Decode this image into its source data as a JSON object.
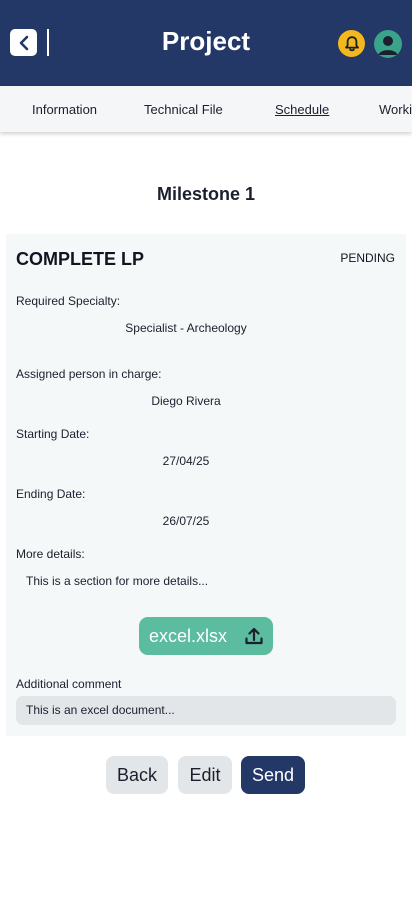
{
  "header": {
    "title": "Project",
    "back_icon": "chevron-left-icon",
    "notification_icon": "bell-icon",
    "profile_icon": "user-avatar-icon",
    "colors": {
      "primary": "#243867",
      "bell": "#f2b81d",
      "avatar": "#3aa48a"
    }
  },
  "tabs": [
    {
      "label": "Information",
      "active": false
    },
    {
      "label": "Technical File",
      "active": false
    },
    {
      "label": "Schedule",
      "active": true
    },
    {
      "label": "Working",
      "active": false
    }
  ],
  "milestone": {
    "title": "Milestone 1"
  },
  "task": {
    "title": "COMPLETE LP",
    "status": "PENDING",
    "specialty_label": "Required Specialty:",
    "specialty_value": "Specialist - Archeology",
    "person_label": "Assigned person in charge:",
    "person_value": "Diego Rivera",
    "start_label": "Starting Date:",
    "start_value": "27/04/25",
    "end_label": "Ending Date:",
    "end_value": "26/07/25",
    "details_label": "More details:",
    "details_value": "This is a section for more details...",
    "file": {
      "name": "excel.xlsx",
      "icon": "upload-icon",
      "color": "#5bbc9f"
    },
    "comment_label": "Additional comment",
    "comment_value": "This is an excel document..."
  },
  "actions": {
    "back_label": "Back",
    "edit_label": "Edit",
    "send_label": "Send"
  }
}
